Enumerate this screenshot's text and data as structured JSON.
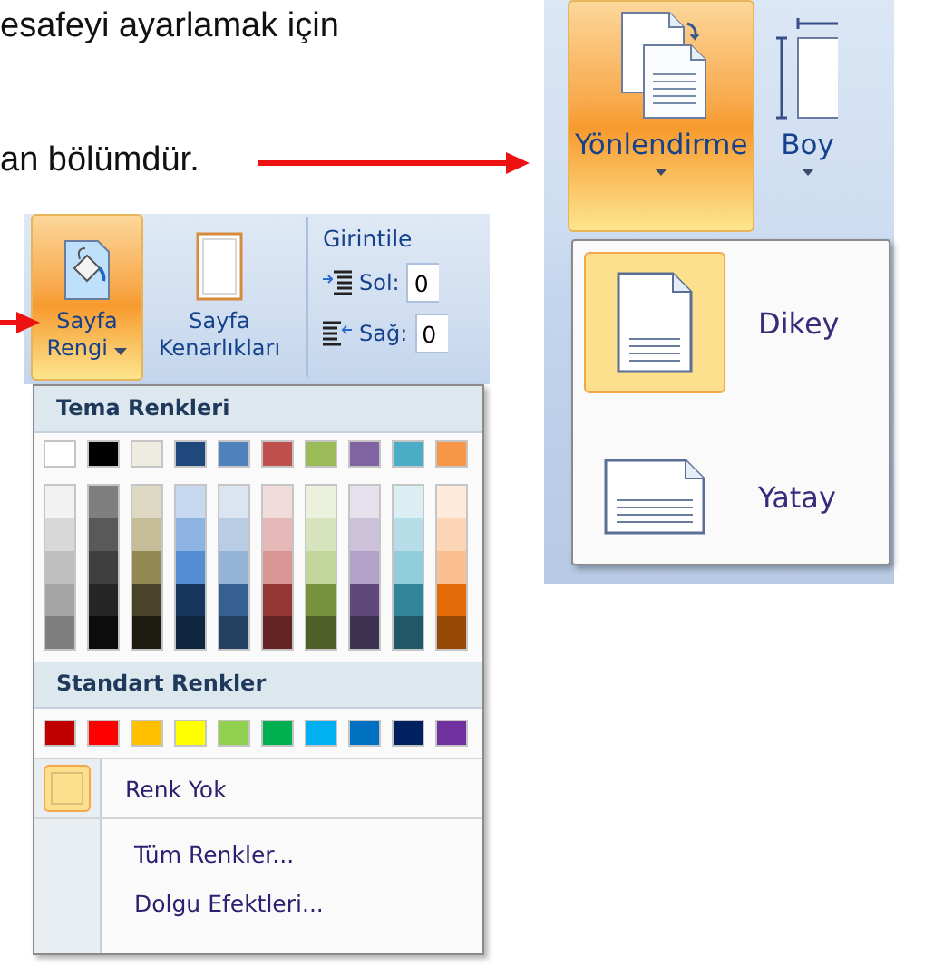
{
  "document": {
    "lines": [
      "esafeyi ayarlamak için",
      "an bölümdür."
    ]
  },
  "orientation_shot": {
    "ribbon_buttons": [
      {
        "label": "Yönlendirme",
        "kind": "orientation",
        "selected": true
      },
      {
        "label": "Boy",
        "kind": "size",
        "selected": false
      }
    ],
    "menu": [
      {
        "label": "Dikey",
        "kind": "portrait",
        "selected": true
      },
      {
        "label": "Yatay",
        "kind": "landscape",
        "selected": false
      }
    ]
  },
  "page_color_shot": {
    "ribbon_buttons": [
      {
        "label": "Sayfa Rengi",
        "kind": "page-color",
        "selected": true
      },
      {
        "label": "Sayfa Kenarlıkları",
        "kind": "page-borders",
        "selected": false
      }
    ],
    "indent": {
      "title": "Girintile",
      "fields": [
        {
          "kind": "left",
          "label": "Sol:",
          "value": "0"
        },
        {
          "kind": "right",
          "label": "Sağ:",
          "value": "0"
        }
      ]
    },
    "palette": {
      "theme_title": "Tema Renkleri",
      "theme_colors": [
        {
          "color": "#ffffff",
          "shades": [
            {
              "color": "#f2f2f2"
            },
            {
              "color": "#d8d8d8"
            },
            {
              "color": "#bfbfbf"
            },
            {
              "color": "#a5a5a5"
            },
            {
              "color": "#7f7f7f"
            }
          ]
        },
        {
          "color": "#000000",
          "shades": [
            {
              "color": "#7f7f7f"
            },
            {
              "color": "#595959"
            },
            {
              "color": "#3f3f3f"
            },
            {
              "color": "#262626"
            },
            {
              "color": "#0c0c0c"
            }
          ]
        },
        {
          "color": "#eeece1",
          "shades": [
            {
              "color": "#ddd9c3"
            },
            {
              "color": "#c4bd97"
            },
            {
              "color": "#938953"
            },
            {
              "color": "#494429"
            },
            {
              "color": "#1d1b10"
            }
          ]
        },
        {
          "color": "#1f497d",
          "shades": [
            {
              "color": "#c6d9f0"
            },
            {
              "color": "#8db3e2"
            },
            {
              "color": "#548dd4"
            },
            {
              "color": "#17365d"
            },
            {
              "color": "#0f243e"
            }
          ]
        },
        {
          "color": "#4f81bd",
          "shades": [
            {
              "color": "#dbe5f1"
            },
            {
              "color": "#b8cce4"
            },
            {
              "color": "#95b3d7"
            },
            {
              "color": "#366092"
            },
            {
              "color": "#244061"
            }
          ]
        },
        {
          "color": "#c0504d",
          "shades": [
            {
              "color": "#f2dcdb"
            },
            {
              "color": "#e5b9b7"
            },
            {
              "color": "#d99694"
            },
            {
              "color": "#953734"
            },
            {
              "color": "#632423"
            }
          ]
        },
        {
          "color": "#9bbb59",
          "shades": [
            {
              "color": "#ebf1dd"
            },
            {
              "color": "#d7e3bc"
            },
            {
              "color": "#c3d69b"
            },
            {
              "color": "#76923c"
            },
            {
              "color": "#4f6128"
            }
          ]
        },
        {
          "color": "#8064a2",
          "shades": [
            {
              "color": "#e5e0ec"
            },
            {
              "color": "#ccc1d9"
            },
            {
              "color": "#b2a2c7"
            },
            {
              "color": "#5f497a"
            },
            {
              "color": "#3f3151"
            }
          ]
        },
        {
          "color": "#4bacc6",
          "shades": [
            {
              "color": "#dbeef3"
            },
            {
              "color": "#b7dde8"
            },
            {
              "color": "#92cddc"
            },
            {
              "color": "#31859b"
            },
            {
              "color": "#205867"
            }
          ]
        },
        {
          "color": "#f79646",
          "shades": [
            {
              "color": "#fdeada"
            },
            {
              "color": "#fbd5b5"
            },
            {
              "color": "#fac08f"
            },
            {
              "color": "#e36c09"
            },
            {
              "color": "#974806"
            }
          ]
        }
      ],
      "standard_title": "Standart Renkler",
      "standard_colors": [
        {
          "color": "#c00000"
        },
        {
          "color": "#ff0000"
        },
        {
          "color": "#ffc000"
        },
        {
          "color": "#ffff00"
        },
        {
          "color": "#92d050"
        },
        {
          "color": "#00b050"
        },
        {
          "color": "#00b0f0"
        },
        {
          "color": "#0070c0"
        },
        {
          "color": "#002060"
        },
        {
          "color": "#7030a0"
        }
      ],
      "menu": [
        {
          "label": "Renk Yok",
          "kind": "no-color",
          "selected": true
        },
        {
          "label": "Tüm Renkler...",
          "kind": "more"
        },
        {
          "label": "Dolgu Efektleri...",
          "kind": "fill"
        }
      ]
    }
  }
}
